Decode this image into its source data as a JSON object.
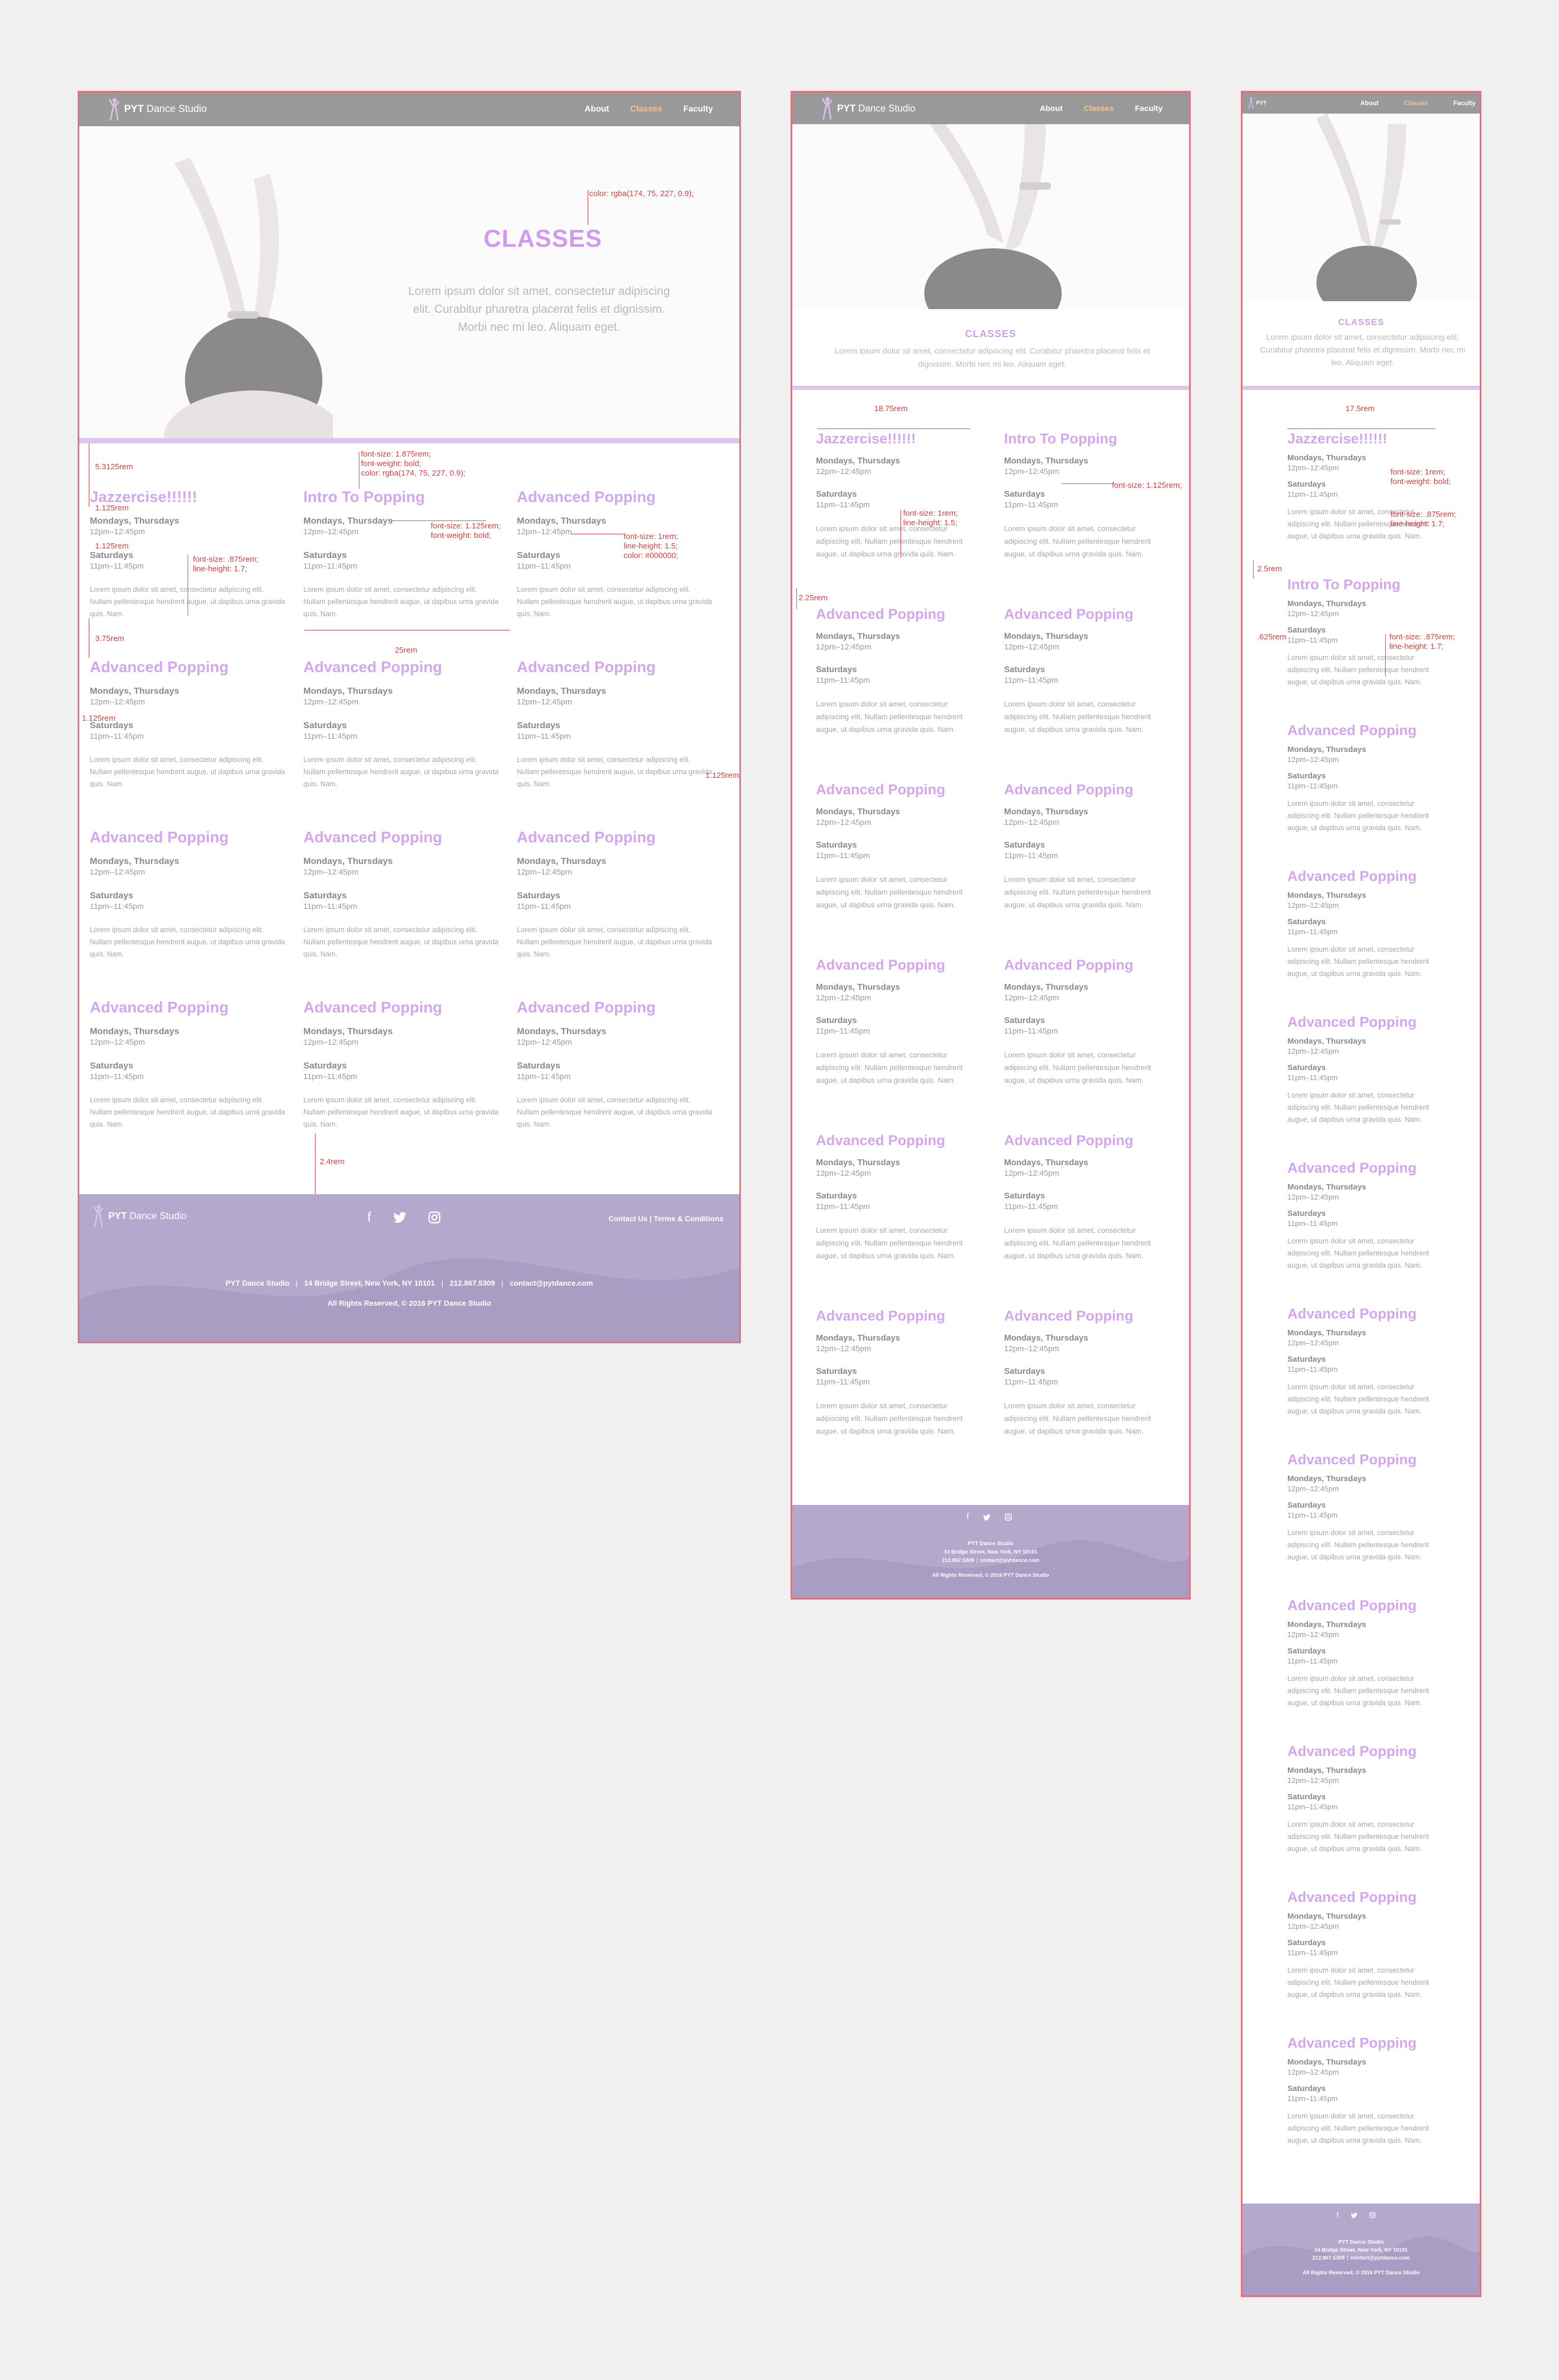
{
  "brand": {
    "bold": "PYT",
    "rest": " Dance Studio"
  },
  "nav": [
    {
      "label": "About",
      "active": false
    },
    {
      "label": "Classes",
      "active": true
    },
    {
      "label": "Faculty",
      "active": false
    }
  ],
  "hero": {
    "title": "CLASSES",
    "text": "Lorem ipsum dolor sit amet, consectetur adipiscing elit. Curabitur pharetra placerat felis et dignissim. Morbi nec mi leo. Aliquam eget."
  },
  "hero_small_text": "Lorem ipsum dolor sit amet, consectetur adipiscing elit. Curabitur pharetra placerat felis et dignissim. Morbi nec mi leo. Aliquam eget.",
  "classes": [
    {
      "title": "Jazzercise!!!!!!",
      "day1": "Mondays, Thursdays",
      "time1": "12pm–12:45pm",
      "day2": "Saturdays",
      "time2": "11pm–11:45pm",
      "desc": "Lorem ipsum dolor sit amet, consectetur adipiscing elit. Nullam pellentesque hendrerit augue, ut dapibus urna gravida quis. Nam."
    },
    {
      "title": "Intro To Popping",
      "day1": "Mondays, Thursdays",
      "time1": "12pm–12:45pm",
      "day2": "Saturdays",
      "time2": "11pm–11:45pm",
      "desc": "Lorem ipsum dolor sit amet, consectetur adipiscing elit. Nullam pellentesque hendrerit augue, ut dapibus urna gravida quis. Nam."
    },
    {
      "title": "Advanced Popping",
      "day1": "Mondays, Thursdays",
      "time1": "12pm–12:45pm",
      "day2": "Saturdays",
      "time2": "11pm–11:45pm",
      "desc": "Lorem ipsum dolor sit amet, consectetur adipiscing elit. Nullam pellentesque hendrerit augue, ut dapibus urna gravida quis. Nam."
    }
  ],
  "repeat_title": "Advanced Popping",
  "footer": {
    "links": "Contact Us | Terms & Conditions",
    "info": [
      "PYT Dance Studio",
      "14 Bridge Street, New York, NY 10101",
      "212.867.5309",
      "contact@pytdance.com"
    ],
    "rights": "All Rights Reserved, © 2016 PYT Dance Studio",
    "social": [
      "facebook-icon",
      "twitter-icon",
      "instagram-icon"
    ]
  },
  "annotations": {
    "hero_color": "color: rgba(174, 75, 227, 0.9);",
    "gap_top": "5.3125rem",
    "h3_spec": [
      "font-size: 1.875rem;",
      "font-weight: bold;",
      "color: rgba(174, 75, 227, 0.9);"
    ],
    "day_spec": [
      "font-size: 1.125rem;",
      "font-weight: bold;"
    ],
    "time_spec": [
      "font-size: 1rem;",
      "line-height: 1.5;",
      "color: #000000;"
    ],
    "p_spec": [
      "font-size: .875rem;",
      "line-height: 1.7;"
    ],
    "r1125": "1.125rem",
    "r375": "3.75rem",
    "r25": "25rem",
    "r24": "2.4rem",
    "t1875": "18.75rem",
    "t225": "2.25rem",
    "t_time": "font-size: 1rem;\nline-height: 1.5;",
    "t_day": "font-size: 1.125rem;",
    "m175": "17.5rem",
    "m25": "2.5rem",
    "m625": ".625rem",
    "m_day": "font-size: 1rem;\nfont-weight: bold;",
    "m_time": "font-size: .875rem;\nline-height: 1.7;",
    "m_p": "font-size: .875rem;\nline-height: 1.7;"
  }
}
